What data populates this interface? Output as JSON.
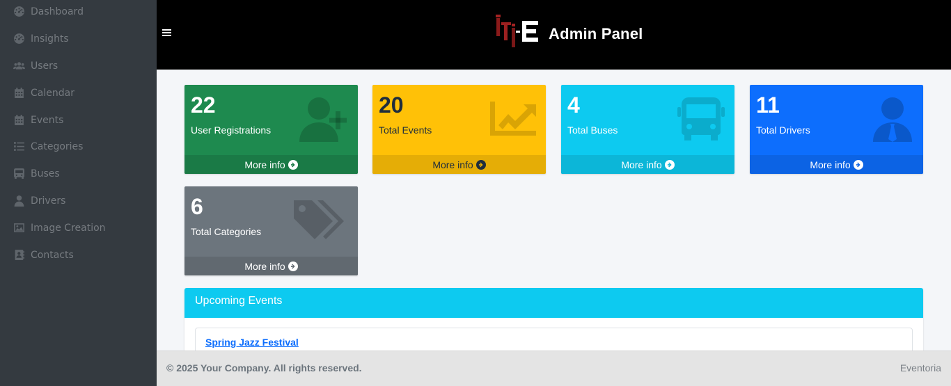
{
  "header": {
    "title": "Admin Panel"
  },
  "sidebar": {
    "items": [
      {
        "label": "Dashboard",
        "icon": "dashboard-icon"
      },
      {
        "label": "Insights",
        "icon": "insights-icon"
      },
      {
        "label": "Users",
        "icon": "users-icon"
      },
      {
        "label": "Calendar",
        "icon": "calendar-icon"
      },
      {
        "label": "Events",
        "icon": "calendar-icon"
      },
      {
        "label": "Categories",
        "icon": "list-icon"
      },
      {
        "label": "Buses",
        "icon": "bus-icon"
      },
      {
        "label": "Drivers",
        "icon": "user-icon"
      },
      {
        "label": "Image Creation",
        "icon": "image-icon"
      },
      {
        "label": "Contacts",
        "icon": "address-book-icon"
      }
    ]
  },
  "stats": [
    {
      "value": "22",
      "label": "User Registrations",
      "more": "More info",
      "icon": "user-plus-icon",
      "color": "#1e8a4f"
    },
    {
      "value": "20",
      "label": "Total Events",
      "more": "More info",
      "icon": "chart-line-icon",
      "color": "#ffc107"
    },
    {
      "value": "4",
      "label": "Total Buses",
      "more": "More info",
      "icon": "bus-icon",
      "color": "#0dcaf0"
    },
    {
      "value": "11",
      "label": "Total Drivers",
      "more": "More info",
      "icon": "user-tie-icon",
      "color": "#0d6efd"
    },
    {
      "value": "6",
      "label": "Total Categories",
      "more": "More info",
      "icon": "tags-icon",
      "color": "#6c757d"
    }
  ],
  "upcoming": {
    "title": "Upcoming Events",
    "events": [
      {
        "name": "Spring Jazz Festival"
      }
    ]
  },
  "footer": {
    "copyright": "© 2025 Your Company. All rights reserved.",
    "brand": "Eventoria"
  }
}
